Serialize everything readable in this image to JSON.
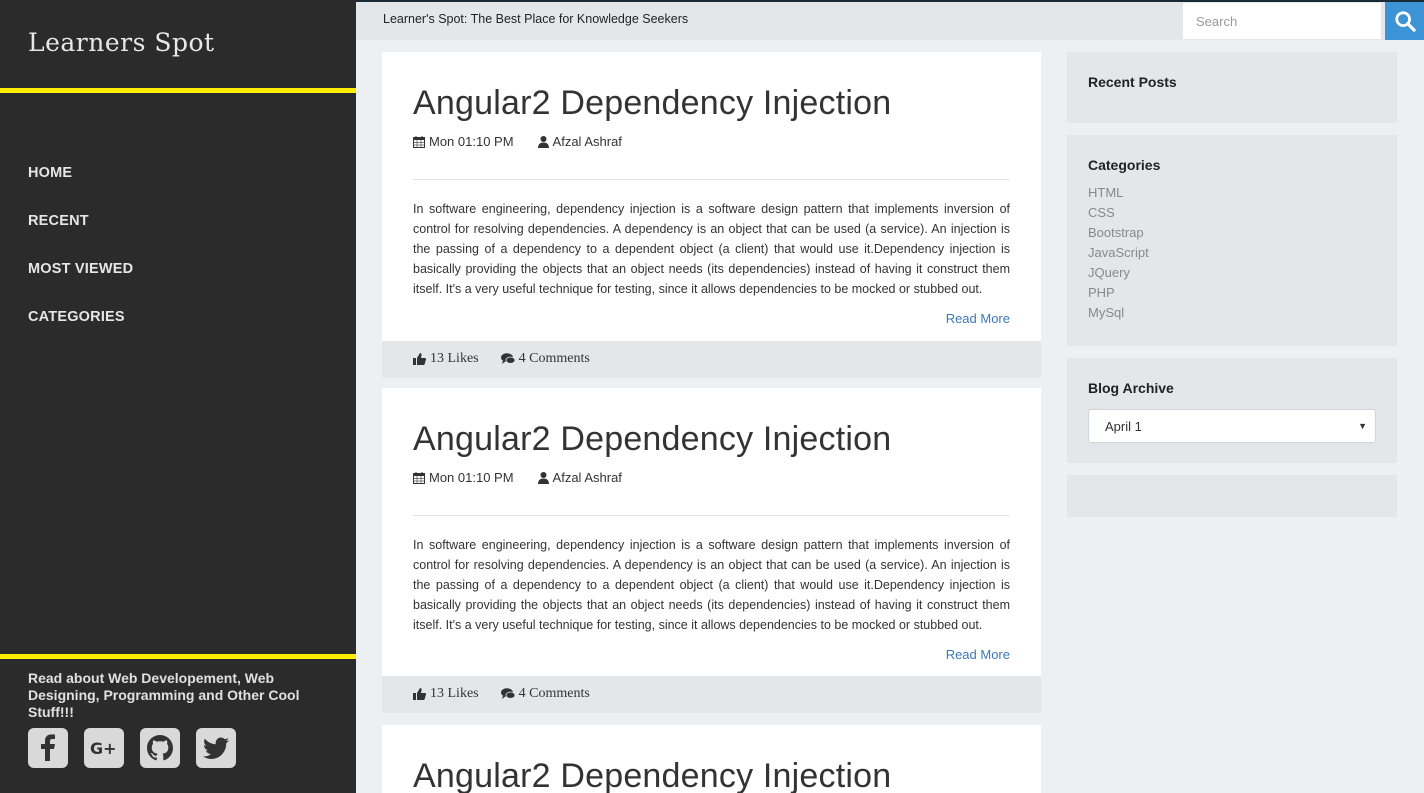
{
  "sidebar": {
    "brand": "Learners Spot",
    "nav": [
      "HOME",
      "RECENT",
      "MOST VIEWED",
      "CATEGORIES"
    ],
    "tagline": "Read about Web Developement, Web Designing, Programming and Other Cool Stuff!!!",
    "socials": [
      "facebook-icon",
      "google-plus-icon",
      "github-icon",
      "twitter-icon"
    ]
  },
  "topbar": {
    "title": "Learner's Spot: The Best Place for Knowledge Seekers",
    "search_placeholder": "Search"
  },
  "posts": [
    {
      "title": "Angular2 Dependency Injection",
      "date": "Mon 01:10 PM",
      "author": "Afzal Ashraf",
      "body": "In software engineering, dependency injection is a software design pattern that implements inversion of control for resolving dependencies. A dependency is an object that can be used (a service). An injection is the passing of a dependency to a dependent object (a client) that would use it.Dependency injection is basically providing the objects that an object needs (its dependencies) instead of having it construct them itself. It's a very useful technique for testing, since it allows dependencies to be mocked or stubbed out.",
      "read_more": "Read More",
      "likes": "13 Likes",
      "comments": "4 Comments"
    },
    {
      "title": "Angular2 Dependency Injection",
      "date": "Mon 01:10 PM",
      "author": "Afzal Ashraf",
      "body": "In software engineering, dependency injection is a software design pattern that implements inversion of control for resolving dependencies. A dependency is an object that can be used (a service). An injection is the passing of a dependency to a dependent object (a client) that would use it.Dependency injection is basically providing the objects that an object needs (its dependencies) instead of having it construct them itself. It's a very useful technique for testing, since it allows dependencies to be mocked or stubbed out.",
      "read_more": "Read More",
      "likes": "13 Likes",
      "comments": "4 Comments"
    },
    {
      "title": "Angular2 Dependency Injection"
    }
  ],
  "widgets": {
    "recent_posts_title": "Recent Posts",
    "categories_title": "Categories",
    "categories": [
      "HTML",
      "CSS",
      "Bootstrap",
      "JavaScript",
      "JQuery",
      "PHP",
      "MySql"
    ],
    "archive_title": "Blog Archive",
    "archive_selected": "April 1"
  },
  "colors": {
    "sidebar_bg": "#2b2b2b",
    "accent_yellow": "#ffee00",
    "search_blue": "#3c93d6",
    "link_blue": "#3c78b4"
  }
}
